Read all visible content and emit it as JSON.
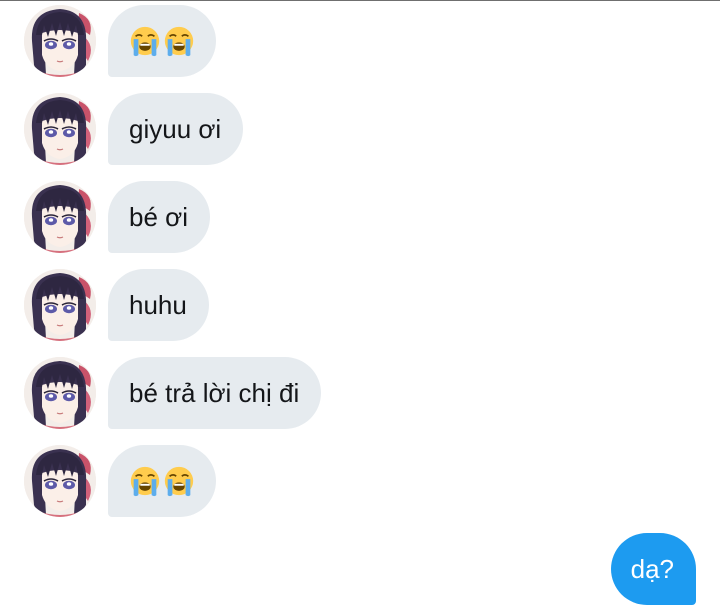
{
  "conversation": {
    "messages": [
      {
        "sender": "contact",
        "kind": "emoji",
        "emoji": [
          "loudly-crying-face",
          "loudly-crying-face"
        ]
      },
      {
        "sender": "contact",
        "kind": "text",
        "text": "giyuu ơi"
      },
      {
        "sender": "contact",
        "kind": "text",
        "text": "bé ơi"
      },
      {
        "sender": "contact",
        "kind": "text",
        "text": "huhu"
      },
      {
        "sender": "contact",
        "kind": "text",
        "text": "bé trả lời chị đi"
      },
      {
        "sender": "contact",
        "kind": "emoji",
        "emoji": [
          "loudly-crying-face",
          "loudly-crying-face"
        ]
      },
      {
        "sender": "me",
        "kind": "text",
        "text": "dạ?"
      }
    ]
  },
  "colors": {
    "incoming_bubble": "#e6ebef",
    "outgoing_bubble": "#1d9bf0",
    "incoming_text": "#141619",
    "outgoing_text": "#ffffff"
  }
}
